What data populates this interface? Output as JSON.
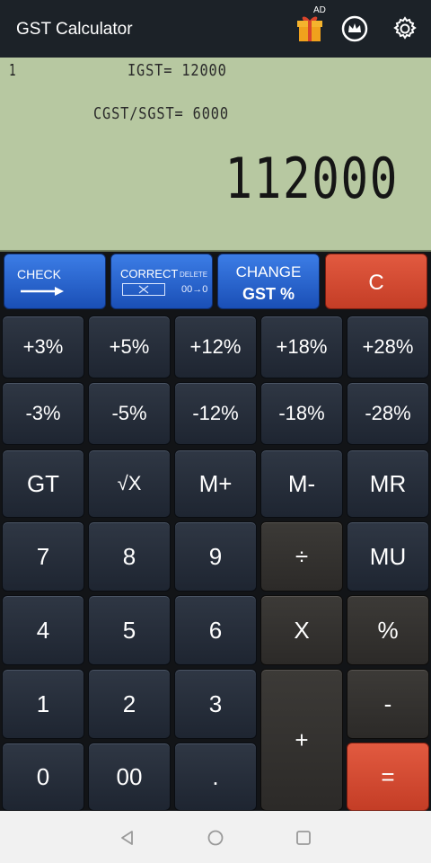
{
  "app": {
    "title": "GST Calculator",
    "ad_tag": "AD",
    "icons": {
      "gift": "gift-icon",
      "crown": "crown-icon",
      "settings": "gear-icon"
    }
  },
  "display": {
    "memory_indicator": "1",
    "igst_line": "IGST= 12000",
    "cgst_line": "CGST/SGST= 6000",
    "main_value": "112000"
  },
  "function_keys": {
    "check": "CHECK",
    "correct": "CORRECT",
    "delete": "DELETE",
    "delete_value": "00→0",
    "change": "CHANGE",
    "gst_percent": "GST %",
    "clear": "C"
  },
  "keys": {
    "plus_rates": [
      "+3%",
      "+5%",
      "+12%",
      "+18%",
      "+28%"
    ],
    "minus_rates": [
      "-3%",
      "-5%",
      "-12%",
      "-18%",
      "-28%"
    ],
    "memory_row": [
      "GT",
      "√X",
      "M+",
      "M-",
      "MR"
    ],
    "row_789": [
      "7",
      "8",
      "9",
      "÷",
      "MU"
    ],
    "row_456": [
      "4",
      "5",
      "6",
      "X",
      "%"
    ],
    "row_123": [
      "1",
      "2",
      "3",
      "-"
    ],
    "plus": "+",
    "row_0": [
      "0",
      "00",
      "."
    ],
    "equals": "="
  },
  "navbar": {
    "icons": [
      "back-icon",
      "home-icon",
      "recents-icon"
    ]
  },
  "colors": {
    "lcd_background": "#b7c8a1",
    "blue_key": "#2a63cf",
    "red_key": "#d14a33",
    "dark_key": "#26303b"
  }
}
